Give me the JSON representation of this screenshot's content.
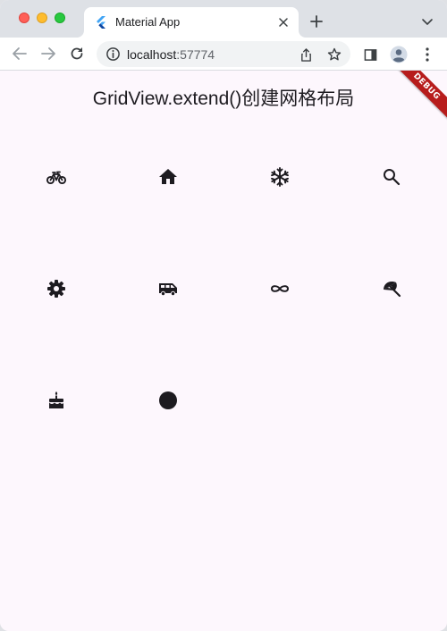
{
  "browser": {
    "tab": {
      "title": "Material App"
    },
    "address": {
      "host": "localhost",
      "port": ":57774"
    }
  },
  "app": {
    "title": "GridView.extend()创建网格布局",
    "debug_banner": "DEBUG",
    "grid": {
      "icons": [
        "bicycle-icon",
        "home-icon",
        "snowflake-icon",
        "search-icon",
        "settings-icon",
        "van-icon",
        "infinity-icon",
        "beach-umbrella-icon",
        "cake-icon",
        "circle-icon"
      ]
    }
  },
  "colors": {
    "page_background": "#fdf7fd",
    "icon": "#1d1b20",
    "debug_banner": "#b71c1c"
  }
}
